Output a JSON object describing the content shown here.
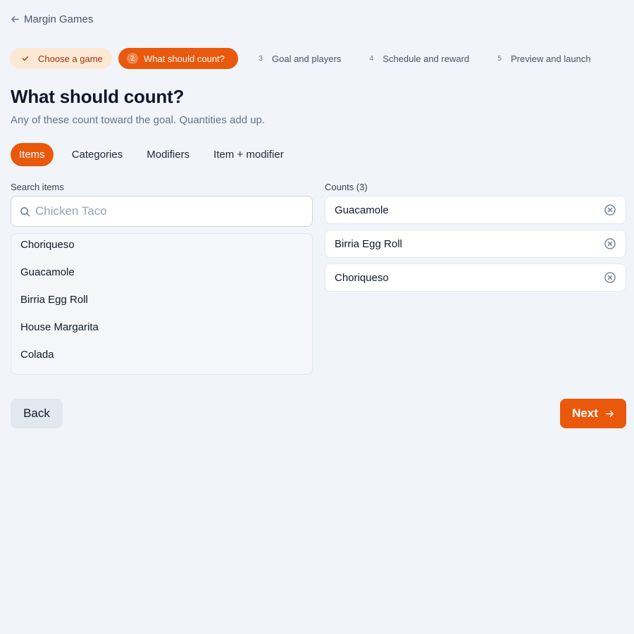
{
  "nav": {
    "back_label": "Margin Games",
    "back_icon": "arrow-left-icon"
  },
  "stepper": {
    "steps": [
      {
        "number": "✓",
        "label": "Choose a game",
        "state": "done"
      },
      {
        "number": "2",
        "label": "What should count?",
        "state": "active"
      },
      {
        "number": "3",
        "label": "Goal and players",
        "state": "upcoming"
      },
      {
        "number": "4",
        "label": "Schedule and reward",
        "state": "upcoming"
      },
      {
        "number": "5",
        "label": "Preview and launch",
        "state": "upcoming"
      }
    ]
  },
  "page": {
    "title": "What should count?",
    "subtitle": "Any of these count toward the goal. Quantities add up."
  },
  "tabs": [
    {
      "label": "Items",
      "active": true
    },
    {
      "label": "Categories",
      "active": false
    },
    {
      "label": "Modifiers",
      "active": false
    },
    {
      "label": "Item + modifier",
      "active": false
    }
  ],
  "search": {
    "label": "Search items",
    "placeholder": "Chicken Taco",
    "value": "",
    "results": [
      "Choriqueso",
      "Guacamole",
      "Birria Egg Roll",
      "House Margarita",
      "Colada"
    ]
  },
  "counts": {
    "label": "Counts (3)",
    "items": [
      "Guacamole",
      "Birria Egg Roll",
      "Choriqueso"
    ]
  },
  "footer": {
    "back_label": "Back",
    "next_label": "Next"
  },
  "colors": {
    "accent": "#ea580c",
    "done_step_bg": "#fde9d3",
    "background": "#f1f4f9"
  }
}
